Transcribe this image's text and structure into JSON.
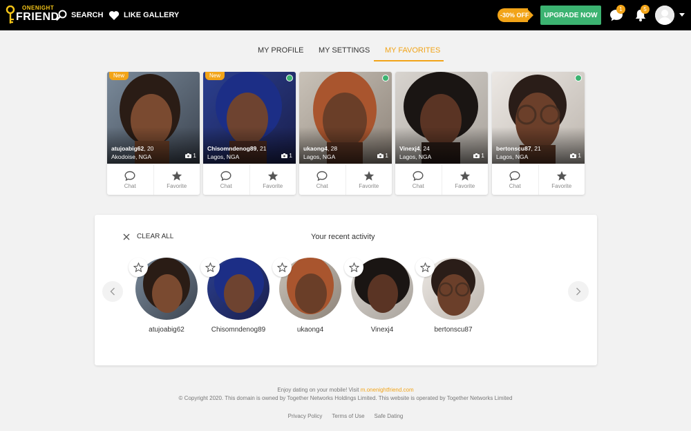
{
  "header": {
    "brand_small": "ONENIGHT",
    "brand_big": "FRIEND",
    "search_label": "SEARCH",
    "like_gallery_label": "LIKE GALLERY",
    "promo_label": "-30% OFF",
    "upgrade_label": "UPGRADE NOW",
    "messages_count": "1",
    "notifications_count": "5"
  },
  "tabs": {
    "profile": "MY PROFILE",
    "settings": "MY SETTINGS",
    "favorites": "MY FAVORITES"
  },
  "cards": [
    {
      "username": "atujoabig62",
      "age": ", 20",
      "location": "Akodoise, NGA",
      "photos": "1",
      "new_label": "New",
      "chat_label": "Chat",
      "favorite_label": "Favorite"
    },
    {
      "username": "Chisomndenog89",
      "age": ", 21",
      "location": "Lagos, NGA",
      "photos": "1",
      "new_label": "New",
      "chat_label": "Chat",
      "favorite_label": "Favorite"
    },
    {
      "username": "ukaong4",
      "age": ", 28",
      "location": "Lagos, NGA",
      "photos": "1",
      "chat_label": "Chat",
      "favorite_label": "Favorite"
    },
    {
      "username": "Vinexj4",
      "age": ", 24",
      "location": "Lagos, NGA",
      "photos": "1",
      "chat_label": "Chat",
      "favorite_label": "Favorite"
    },
    {
      "username": "bertonscu87",
      "age": ", 21",
      "location": "Lagos, NGA",
      "photos": "1",
      "chat_label": "Chat",
      "favorite_label": "Favorite"
    }
  ],
  "activity": {
    "clear_all_label": "CLEAR ALL",
    "title": "Your recent activity",
    "items": [
      {
        "name": "atujoabig62"
      },
      {
        "name": "Chisomndenog89"
      },
      {
        "name": "ukaong4"
      },
      {
        "name": "Vinexj4"
      },
      {
        "name": "bertonscu87"
      }
    ]
  },
  "footer": {
    "mobile_text": "Enjoy dating on your mobile! Visit ",
    "mobile_link": "m.onenightfriend.com",
    "copyright": "© Copyright 2020. This domain is owned by Together Networks Holdings Limited. This website is operated by Together Networks Limited",
    "links": [
      "Privacy Policy",
      "Terms of Use",
      "Safe Dating"
    ]
  },
  "colors": {
    "accent": "#f2a418",
    "upgrade": "#3cb371",
    "online": "#3cb371"
  }
}
